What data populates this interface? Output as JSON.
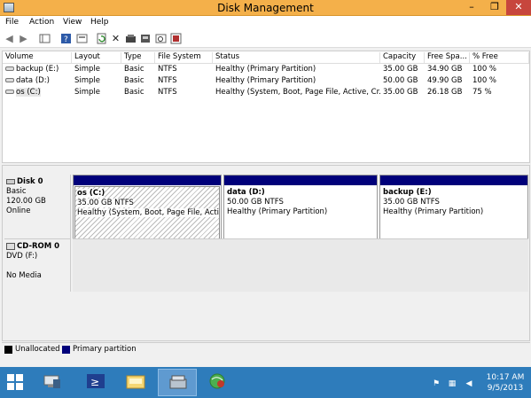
{
  "window": {
    "title": "Disk Management",
    "min": "–",
    "max": "❐",
    "close": "✕"
  },
  "menu": [
    "File",
    "Action",
    "View",
    "Help"
  ],
  "toolbar_icons": [
    "back-icon",
    "forward-icon",
    "console-tree-icon",
    "help-icon",
    "properties-icon",
    "refresh-icon",
    "delete-icon",
    "open-icon",
    "explore-icon",
    "rescan-icon",
    "export-icon"
  ],
  "volume_list": {
    "columns": [
      "Volume",
      "Layout",
      "Type",
      "File System",
      "Status",
      "Capacity",
      "Free Spa...",
      "% Free"
    ],
    "rows": [
      {
        "volume": "backup (E:)",
        "layout": "Simple",
        "type": "Basic",
        "fs": "NTFS",
        "status": "Healthy (Primary Partition)",
        "capacity": "35.00 GB",
        "free": "34.90 GB",
        "pct": "100 %"
      },
      {
        "volume": "data (D:)",
        "layout": "Simple",
        "type": "Basic",
        "fs": "NTFS",
        "status": "Healthy (Primary Partition)",
        "capacity": "50.00 GB",
        "free": "49.90 GB",
        "pct": "100 %"
      },
      {
        "volume": "os (C:)",
        "layout": "Simple",
        "type": "Basic",
        "fs": "NTFS",
        "status": "Healthy (System, Boot, Page File, Active, Cr...",
        "capacity": "35.00 GB",
        "free": "26.18 GB",
        "pct": "75 %"
      }
    ]
  },
  "disk0": {
    "name": "Disk 0",
    "type": "Basic",
    "size": "120.00 GB",
    "state": "Online",
    "partitions": [
      {
        "name": "os  (C:)",
        "size": "35.00 GB NTFS",
        "status": "Healthy (System, Boot, Page File, Active, Cr"
      },
      {
        "name": "data  (D:)",
        "size": "50.00 GB NTFS",
        "status": "Healthy (Primary Partition)"
      },
      {
        "name": "backup  (E:)",
        "size": "35.00 GB NTFS",
        "status": "Healthy (Primary Partition)"
      }
    ]
  },
  "cdrom0": {
    "name": "CD-ROM 0",
    "drive": "DVD (F:)",
    "media": "No Media"
  },
  "legend": [
    {
      "label": "Unallocated",
      "color": "#000000"
    },
    {
      "label": "Primary partition",
      "color": "#00007a"
    }
  ],
  "taskbar": {
    "time": "10:17 AM",
    "date": "9/5/2013"
  },
  "colors": {
    "titlebar": "#f4b04a",
    "taskbar": "#2e7cbb",
    "partition_bar": "#00007a",
    "close_button": "#c7463d"
  }
}
